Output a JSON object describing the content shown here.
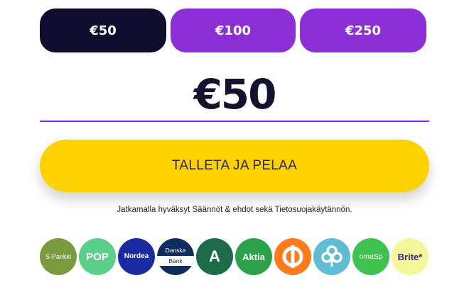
{
  "amount_options": [
    {
      "label": "€50",
      "selected": true
    },
    {
      "label": "€100",
      "selected": false
    },
    {
      "label": "€250",
      "selected": false
    }
  ],
  "amount_input": {
    "value": "€50"
  },
  "deposit_button": {
    "label": "TALLETA JA PELAA"
  },
  "terms_text": "Jatkamalla hyväksyt Säännöt & ehdot sekä Tietosuojakäytännön.",
  "banks": [
    {
      "name": "S-Pankki",
      "icon": "s-pankki-logo",
      "color": "#7a9a3e"
    },
    {
      "name": "POP",
      "icon": "pop-logo",
      "color": "#5bd08a"
    },
    {
      "name": "Nordea",
      "icon": "nordea-logo",
      "color": "#1a2aa0"
    },
    {
      "name_line1": "Danske",
      "name_line2": "Bank",
      "icon": "danske-bank-logo",
      "color": "#0f2d5c"
    },
    {
      "name": "A",
      "icon": "alandsbanken-logo",
      "color": "#1e6b4a"
    },
    {
      "name": "Aktia",
      "icon": "aktia-logo",
      "color": "#2aa24a"
    },
    {
      "name": "op",
      "icon": "op-logo",
      "color": "#ff7a1a"
    },
    {
      "name": "",
      "icon": "saastopankki-logo",
      "color": "#5fbcd3"
    },
    {
      "name": "omaSp",
      "icon": "omasp-logo",
      "color": "#3ec14d"
    },
    {
      "name": "Brite*",
      "icon": "brite-logo",
      "color": "#f3f79a"
    }
  ]
}
